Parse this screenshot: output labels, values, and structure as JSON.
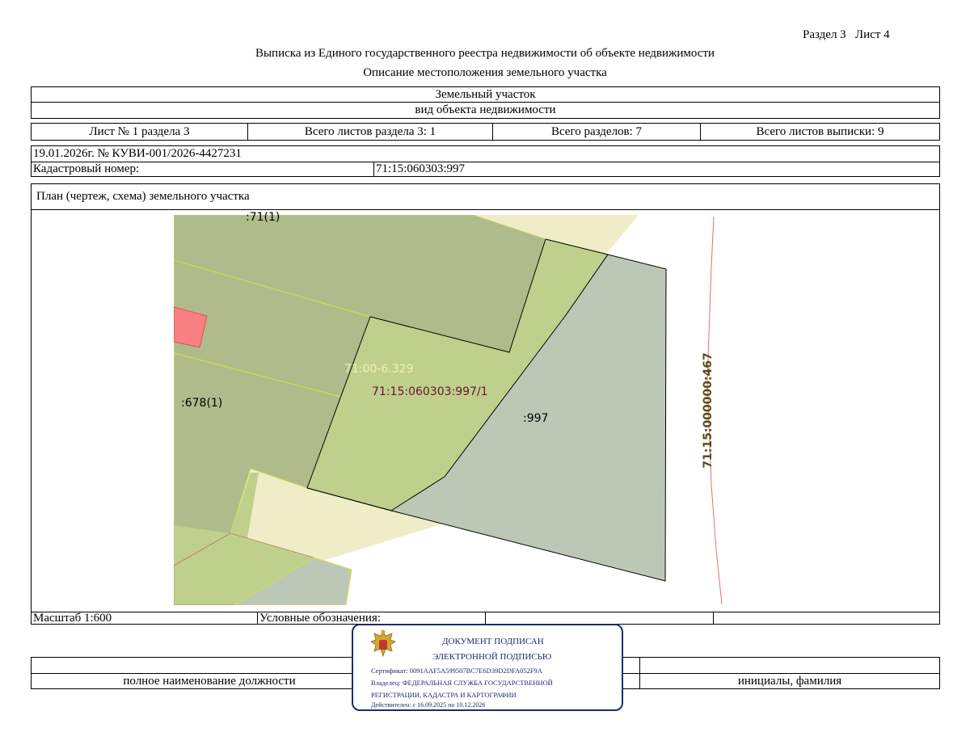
{
  "header": {
    "section_sheet": "Раздел 3   Лист 4",
    "title": "Выписка из Единого государственного реестра недвижимости об объекте недвижимости",
    "subtitle": "Описание местоположения земельного участка"
  },
  "object": {
    "type": "Земельный участок",
    "type_caption": "вид объекта недвижимости"
  },
  "sheet_info": {
    "sheet_of_section": "Лист № 1 раздела 3",
    "total_sheets_section": "Всего листов раздела 3: 1",
    "total_sections": "Всего разделов: 7",
    "total_sheets_extract": "Всего листов выписки: 9"
  },
  "record": {
    "date_number": "19.01.2026г. № КУВИ-001/2026-4427231",
    "cadastral_label": "Кадастровый номер:",
    "cadastral_value": "71:15:060303:997"
  },
  "plan": {
    "title": "План (чертеж, схема) земельного участка",
    "labels": {
      "parcel_71": ":71(1)",
      "parcel_678": ":678(1)",
      "zone": "71:00-6.329",
      "part": "71:15:060303:997/1",
      "parcel_997": ":997",
      "road": "71:15:000000:467"
    },
    "colors": {
      "dark_green": "#b0bb8b",
      "light_green": "#bfd08c",
      "gray_green": "#bcc8b6",
      "cream": "#eeedc8",
      "red": "#f98080"
    }
  },
  "footer": {
    "scale": "Масштаб 1:600",
    "legend_label": "Условные обозначения:",
    "position_caption": "полное наименование должности",
    "name_caption": "инициалы, фамилия"
  },
  "stamp": {
    "line1": "ДОКУМЕНТ ПОДПИСАН",
    "line2": "ЭЛЕКТРОННОЙ ПОДПИСЬЮ",
    "certificate": "Сертификат: 0091AAF5A599507BC7E6D39D2DFA052F9A",
    "owner_line1": "Владелец: ФЕДЕРАЛЬНАЯ СЛУЖБА ГОСУДАРСТВЕННОЙ",
    "owner_line2": "РЕГИСТРАЦИИ, КАДАСТРА И КАРТОГРАФИИ",
    "validity": "Действителен: с 16.09.2025 по 10.12.2026",
    "emblem_icon": "russian-emblem-icon"
  }
}
